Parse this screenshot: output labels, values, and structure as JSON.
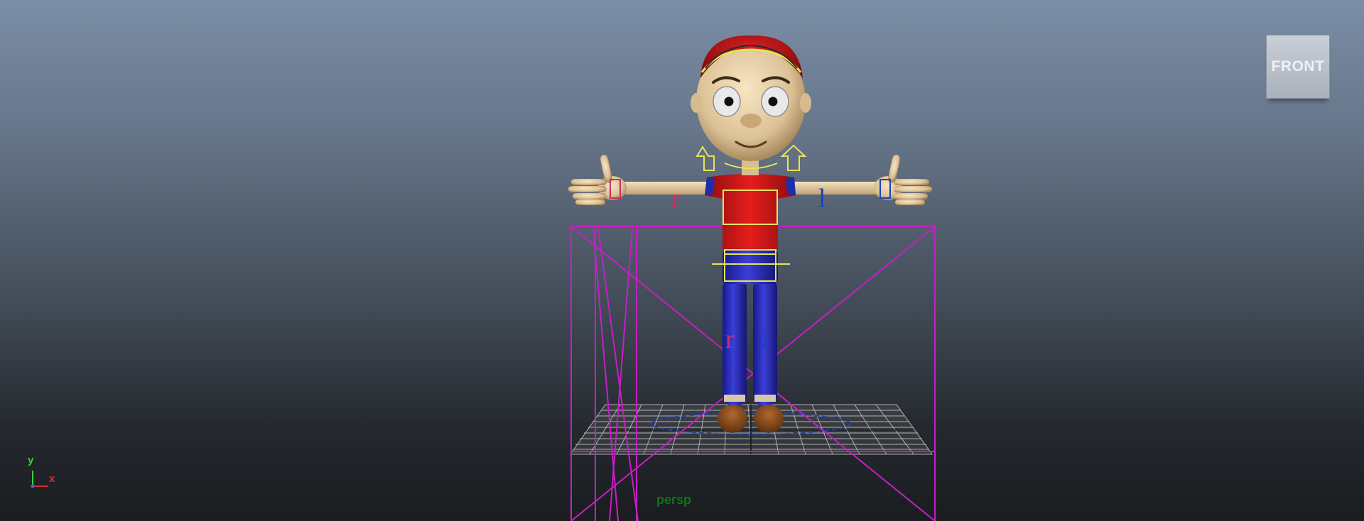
{
  "viewport": {
    "camera_label": "persp",
    "view_cube_face": "FRONT",
    "axis_labels": {
      "y": "y",
      "x": "x"
    },
    "side_tags": {
      "right": "r",
      "left": "l"
    },
    "colors": {
      "background_top": "#7b8ea6",
      "background_bottom": "#1a1c1f",
      "selection_magenta": "#c51fc5",
      "control_yellow": "#e8e35a",
      "right_side_color": "#c8306a",
      "left_side_color": "#1c44b8",
      "camera_label_green": "#13721f"
    }
  },
  "icons": {
    "view_cube": "view-cube-icon",
    "axis_indicator": "axis-indicator-icon"
  }
}
